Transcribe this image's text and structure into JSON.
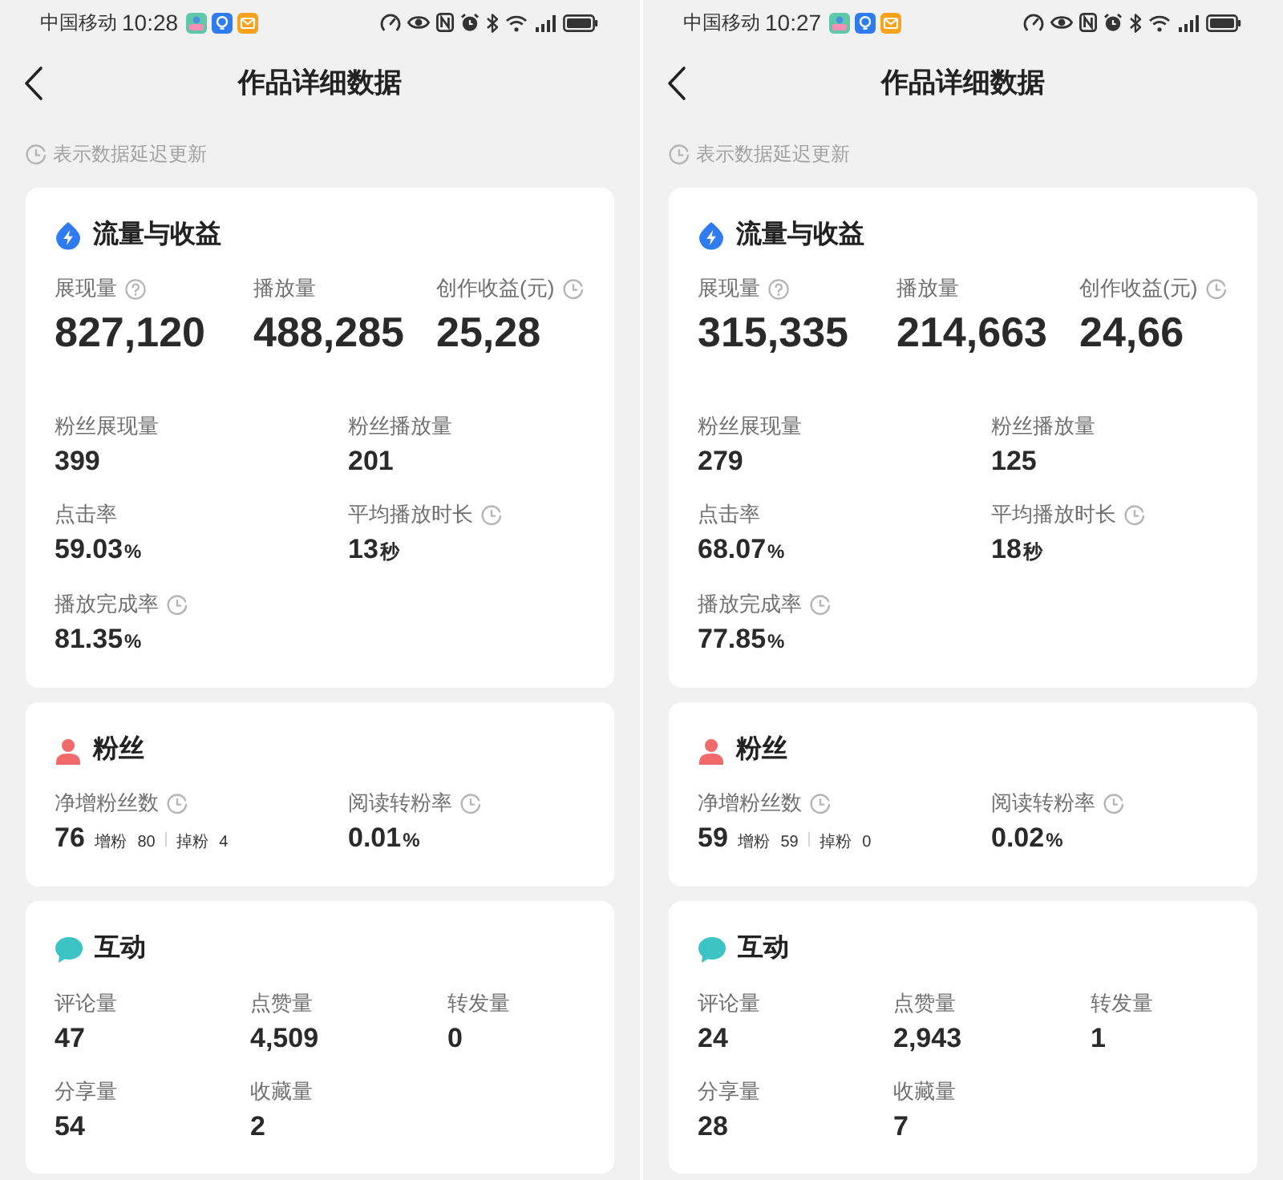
{
  "screens": [
    {
      "status_bar": {
        "carrier": "中国移动",
        "time": "10:28"
      },
      "header": {
        "title": "作品详细数据"
      },
      "notice": "表示数据延迟更新",
      "sections": [
        {
          "kind": "traffic",
          "title": "流量与收益",
          "headline_metrics": [
            {
              "label": "展现量",
              "value": "827,120",
              "help": true,
              "delayed": false
            },
            {
              "label": "播放量",
              "value": "488,285",
              "help": false,
              "delayed": false
            },
            {
              "label": "创作收益(元)",
              "value": "25,28",
              "help": false,
              "delayed": true
            }
          ],
          "metrics": [
            {
              "label": "粉丝展现量",
              "value": "399",
              "help": false,
              "delayed": false
            },
            {
              "label": "粉丝播放量",
              "value": "201",
              "help": false,
              "delayed": false
            },
            {
              "label": "点击率",
              "value": "59.03",
              "unit": "%",
              "help": false,
              "delayed": false
            },
            {
              "label": "平均播放时长",
              "value": "13",
              "unit": "秒",
              "help": false,
              "delayed": true
            },
            {
              "label": "播放完成率",
              "value": "81.35",
              "unit": "%",
              "help": false,
              "delayed": true
            }
          ]
        },
        {
          "kind": "fans",
          "title": "粉丝",
          "metrics": [
            {
              "label": "净增粉丝数",
              "value": "76",
              "help": false,
              "delayed": true,
              "breakdown": [
                {
                  "label": "增粉",
                  "value": "80"
                },
                {
                  "label": "掉粉",
                  "value": "4"
                }
              ]
            },
            {
              "label": "阅读转粉率",
              "value": "0.01",
              "unit": "%",
              "help": false,
              "delayed": true
            }
          ]
        },
        {
          "kind": "interaction",
          "title": "互动",
          "metrics": [
            {
              "label": "评论量",
              "value": "47",
              "help": false,
              "delayed": false
            },
            {
              "label": "点赞量",
              "value": "4,509",
              "help": false,
              "delayed": false
            },
            {
              "label": "转发量",
              "value": "0",
              "help": false,
              "delayed": false
            },
            {
              "label": "分享量",
              "value": "54",
              "help": false,
              "delayed": false
            },
            {
              "label": "收藏量",
              "value": "2",
              "help": false,
              "delayed": false
            }
          ]
        }
      ]
    },
    {
      "status_bar": {
        "carrier": "中国移动",
        "time": "10:27"
      },
      "header": {
        "title": "作品详细数据"
      },
      "notice": "表示数据延迟更新",
      "sections": [
        {
          "kind": "traffic",
          "title": "流量与收益",
          "headline_metrics": [
            {
              "label": "展现量",
              "value": "315,335",
              "help": true,
              "delayed": false
            },
            {
              "label": "播放量",
              "value": "214,663",
              "help": false,
              "delayed": false
            },
            {
              "label": "创作收益(元)",
              "value": "24,66",
              "help": false,
              "delayed": true
            }
          ],
          "metrics": [
            {
              "label": "粉丝展现量",
              "value": "279",
              "help": false,
              "delayed": false
            },
            {
              "label": "粉丝播放量",
              "value": "125",
              "help": false,
              "delayed": false
            },
            {
              "label": "点击率",
              "value": "68.07",
              "unit": "%",
              "help": false,
              "delayed": false
            },
            {
              "label": "平均播放时长",
              "value": "18",
              "unit": "秒",
              "help": false,
              "delayed": true
            },
            {
              "label": "播放完成率",
              "value": "77.85",
              "unit": "%",
              "help": false,
              "delayed": true
            }
          ]
        },
        {
          "kind": "fans",
          "title": "粉丝",
          "metrics": [
            {
              "label": "净增粉丝数",
              "value": "59",
              "help": false,
              "delayed": true,
              "breakdown": [
                {
                  "label": "增粉",
                  "value": "59"
                },
                {
                  "label": "掉粉",
                  "value": "0"
                }
              ]
            },
            {
              "label": "阅读转粉率",
              "value": "0.02",
              "unit": "%",
              "help": false,
              "delayed": true
            }
          ]
        },
        {
          "kind": "interaction",
          "title": "互动",
          "metrics": [
            {
              "label": "评论量",
              "value": "24",
              "help": false,
              "delayed": false
            },
            {
              "label": "点赞量",
              "value": "2,943",
              "help": false,
              "delayed": false
            },
            {
              "label": "转发量",
              "value": "1",
              "help": false,
              "delayed": false
            },
            {
              "label": "分享量",
              "value": "28",
              "help": false,
              "delayed": false
            },
            {
              "label": "收藏量",
              "value": "7",
              "help": false,
              "delayed": false
            }
          ]
        }
      ]
    }
  ]
}
